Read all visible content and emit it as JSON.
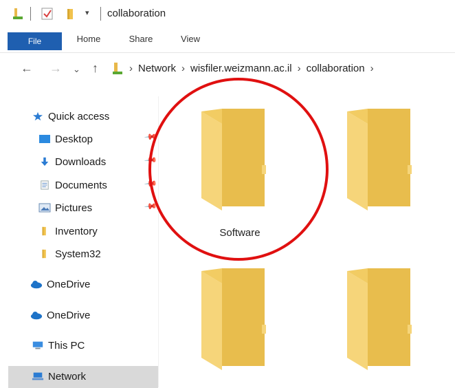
{
  "window": {
    "title": "collaboration",
    "quick_access_dropdown": "▾"
  },
  "ribbon": {
    "tabs": [
      {
        "label": "File"
      },
      {
        "label": "Home"
      },
      {
        "label": "Share"
      },
      {
        "label": "View"
      }
    ]
  },
  "address_bar": {
    "breadcrumb": [
      "Network",
      "wisfiler.weizmann.ac.il",
      "collaboration"
    ]
  },
  "sidebar": {
    "items": [
      {
        "label": "Quick access",
        "icon": "star-icon"
      },
      {
        "label": "Desktop",
        "icon": "desktop-icon"
      },
      {
        "label": "Downloads",
        "icon": "download-arrow-icon"
      },
      {
        "label": "Documents",
        "icon": "documents-icon"
      },
      {
        "label": "Pictures",
        "icon": "pictures-icon"
      },
      {
        "label": "Inventory",
        "icon": "folder-icon"
      },
      {
        "label": "System32",
        "icon": "folder-icon"
      },
      {
        "label": "OneDrive",
        "icon": "cloud-icon"
      },
      {
        "label": "OneDrive",
        "icon": "cloud-icon"
      },
      {
        "label": "This PC",
        "icon": "computer-icon"
      },
      {
        "label": "Network",
        "icon": "network-icon",
        "selected": true
      }
    ]
  },
  "content": {
    "folders": [
      {
        "label": "Software",
        "highlighted": true
      },
      {
        "label": ""
      },
      {
        "label": ""
      },
      {
        "label": ""
      }
    ]
  },
  "colors": {
    "file_tab": "#1f5fb0",
    "folder_front": "#f6d57a",
    "folder_back": "#e8bd4d",
    "highlight": "#e01010",
    "selection": "#d9d9d9"
  }
}
